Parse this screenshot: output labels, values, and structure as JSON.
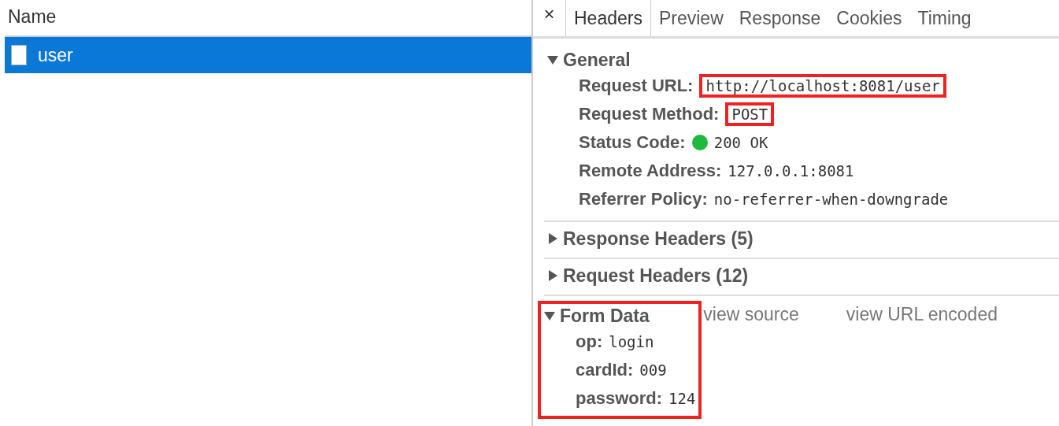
{
  "request_list": {
    "column": "Name",
    "rows": [
      {
        "name": "user",
        "selected": true
      }
    ]
  },
  "details": {
    "close": "×",
    "tabs": [
      {
        "label": "Headers",
        "selected": true
      },
      {
        "label": "Preview",
        "selected": false
      },
      {
        "label": "Response",
        "selected": false
      },
      {
        "label": "Cookies",
        "selected": false
      },
      {
        "label": "Timing",
        "selected": false
      }
    ],
    "sections": [
      {
        "title": "General",
        "expanded": true,
        "highlighted": false,
        "fields": [
          {
            "label": "Request URL:",
            "value": "http://localhost:8081/user",
            "highlighted": true
          },
          {
            "label": "Request Method:",
            "value": "POST",
            "highlighted": true
          },
          {
            "label": "Status Code:",
            "value": "200 OK",
            "highlighted": false,
            "color": "#1db93c"
          },
          {
            "label": "Remote Address:",
            "value": "127.0.0.1:8081",
            "highlighted": false
          },
          {
            "label": "Referrer Policy:",
            "value": "no-referrer-when-downgrade",
            "highlighted": false
          }
        ]
      },
      {
        "title": "Response Headers (5)",
        "expanded": false,
        "highlighted": false
      },
      {
        "title": "Request Headers (12)",
        "expanded": false,
        "highlighted": false
      },
      {
        "title": "Form Data",
        "expanded": true,
        "highlighted": true,
        "links": [
          "view source",
          "view URL encoded"
        ],
        "fields": [
          {
            "label": "op:",
            "value": "login",
            "highlighted": false
          },
          {
            "label": "cardId:",
            "value": "009",
            "highlighted": false
          },
          {
            "label": "password:",
            "value": "124",
            "highlighted": false
          }
        ]
      }
    ]
  }
}
